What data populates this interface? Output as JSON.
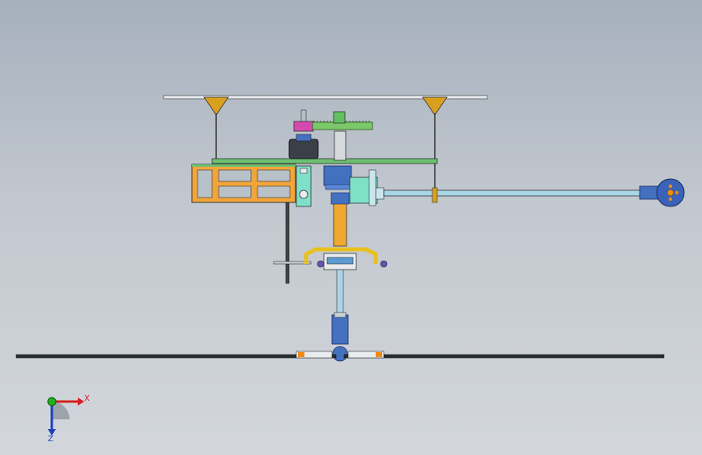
{
  "scene": {
    "description_free": true,
    "colors": {
      "background_top": "#a6b0bd",
      "background_bottom": "#d3d7dc",
      "frame_orange": "#f2a53a",
      "shaft_orange": "#f0a830",
      "gear_green": "#7cc96a",
      "motor_dark": "#3a3f48",
      "servo_cyan": "#7fe0c8",
      "blue_hub": "#4470c0",
      "bracket_yellow": "#e8c020",
      "rod_light": "#a9d6e6",
      "tail_rotor_orange": "#f08a10",
      "plate_green": "#6cc070"
    }
  },
  "triad": {
    "x_label": "X",
    "z_label": "Z",
    "x_color": "#d62020",
    "z_color": "#2040c0",
    "y_color": "#20b020"
  }
}
